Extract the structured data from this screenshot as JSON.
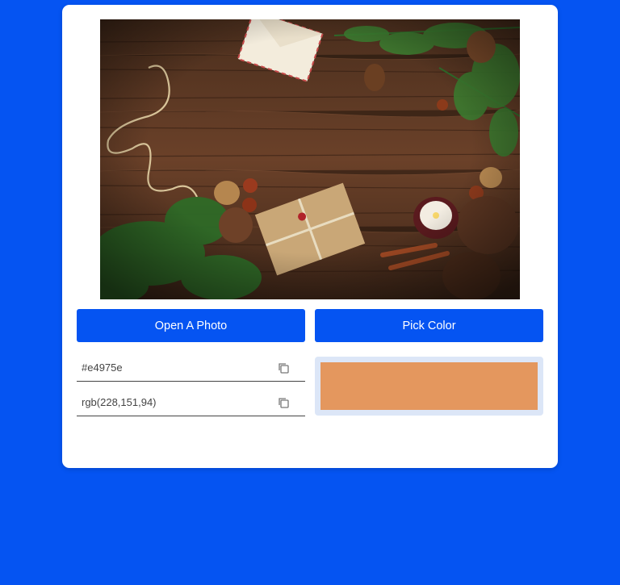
{
  "buttons": {
    "open_label": "Open A Photo",
    "pick_label": "Pick Color"
  },
  "fields": {
    "hex_value": "#e4975e",
    "rgb_value": "rgb(228,151,94)"
  },
  "icons": {
    "copy": "copy-icon"
  },
  "colors": {
    "background": "#0554f2",
    "card": "#ffffff",
    "button": "#0554f2",
    "swatch": "#e4975e",
    "swatch_border": "#dce6f7"
  }
}
